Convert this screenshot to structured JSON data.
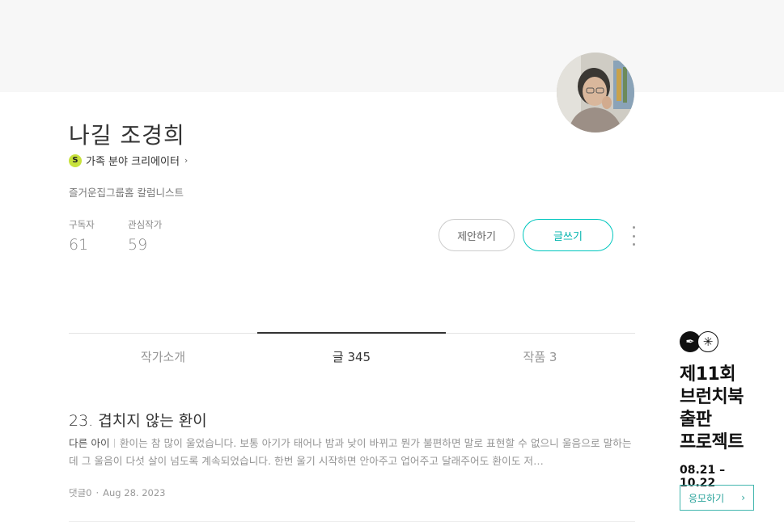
{
  "profile": {
    "name": "나길 조경희",
    "creator_badge": "S",
    "creator_label": "가족 분야 크리에이터",
    "bio": "즐거운집그룹홈 칼럼니스트",
    "stats": [
      {
        "label": "구독자",
        "value": "61"
      },
      {
        "label": "관심작가",
        "value": "59"
      }
    ],
    "propose_button": "제안하기",
    "write_button": "글쓰기"
  },
  "tabs": [
    {
      "label": "작가소개",
      "active": false
    },
    {
      "label": "글 345",
      "active": true
    },
    {
      "label": "작품 3",
      "active": false
    }
  ],
  "post": {
    "title": "23. 겹치지 않는 환이",
    "tag": "다른 아이",
    "excerpt": "환이는 참 많이 울었습니다. 보통 아기가 태어나 밤과 낮이 바뀌고 뭔가 불편하면 말로 표현할 수 없으니 울음으로 말하는데 그 울음이 다섯 살이 넘도록 계속되었습니다. 한번 울기 시작하면 안아주고 업어주고 달래주어도 환이도 저…",
    "comments": "댓글0",
    "dot": "·",
    "date": "Aug 28. 2023"
  },
  "banner": {
    "headline": "제11회\n브런치북\n출판\n프로젝트",
    "dates": "08.21 – 10.22",
    "apply_button": "응모하기",
    "apply_chevron": "›"
  },
  "colors": {
    "accent": "#00c6be",
    "badge": "#c8e23c",
    "cover": "#f7f7f7"
  }
}
